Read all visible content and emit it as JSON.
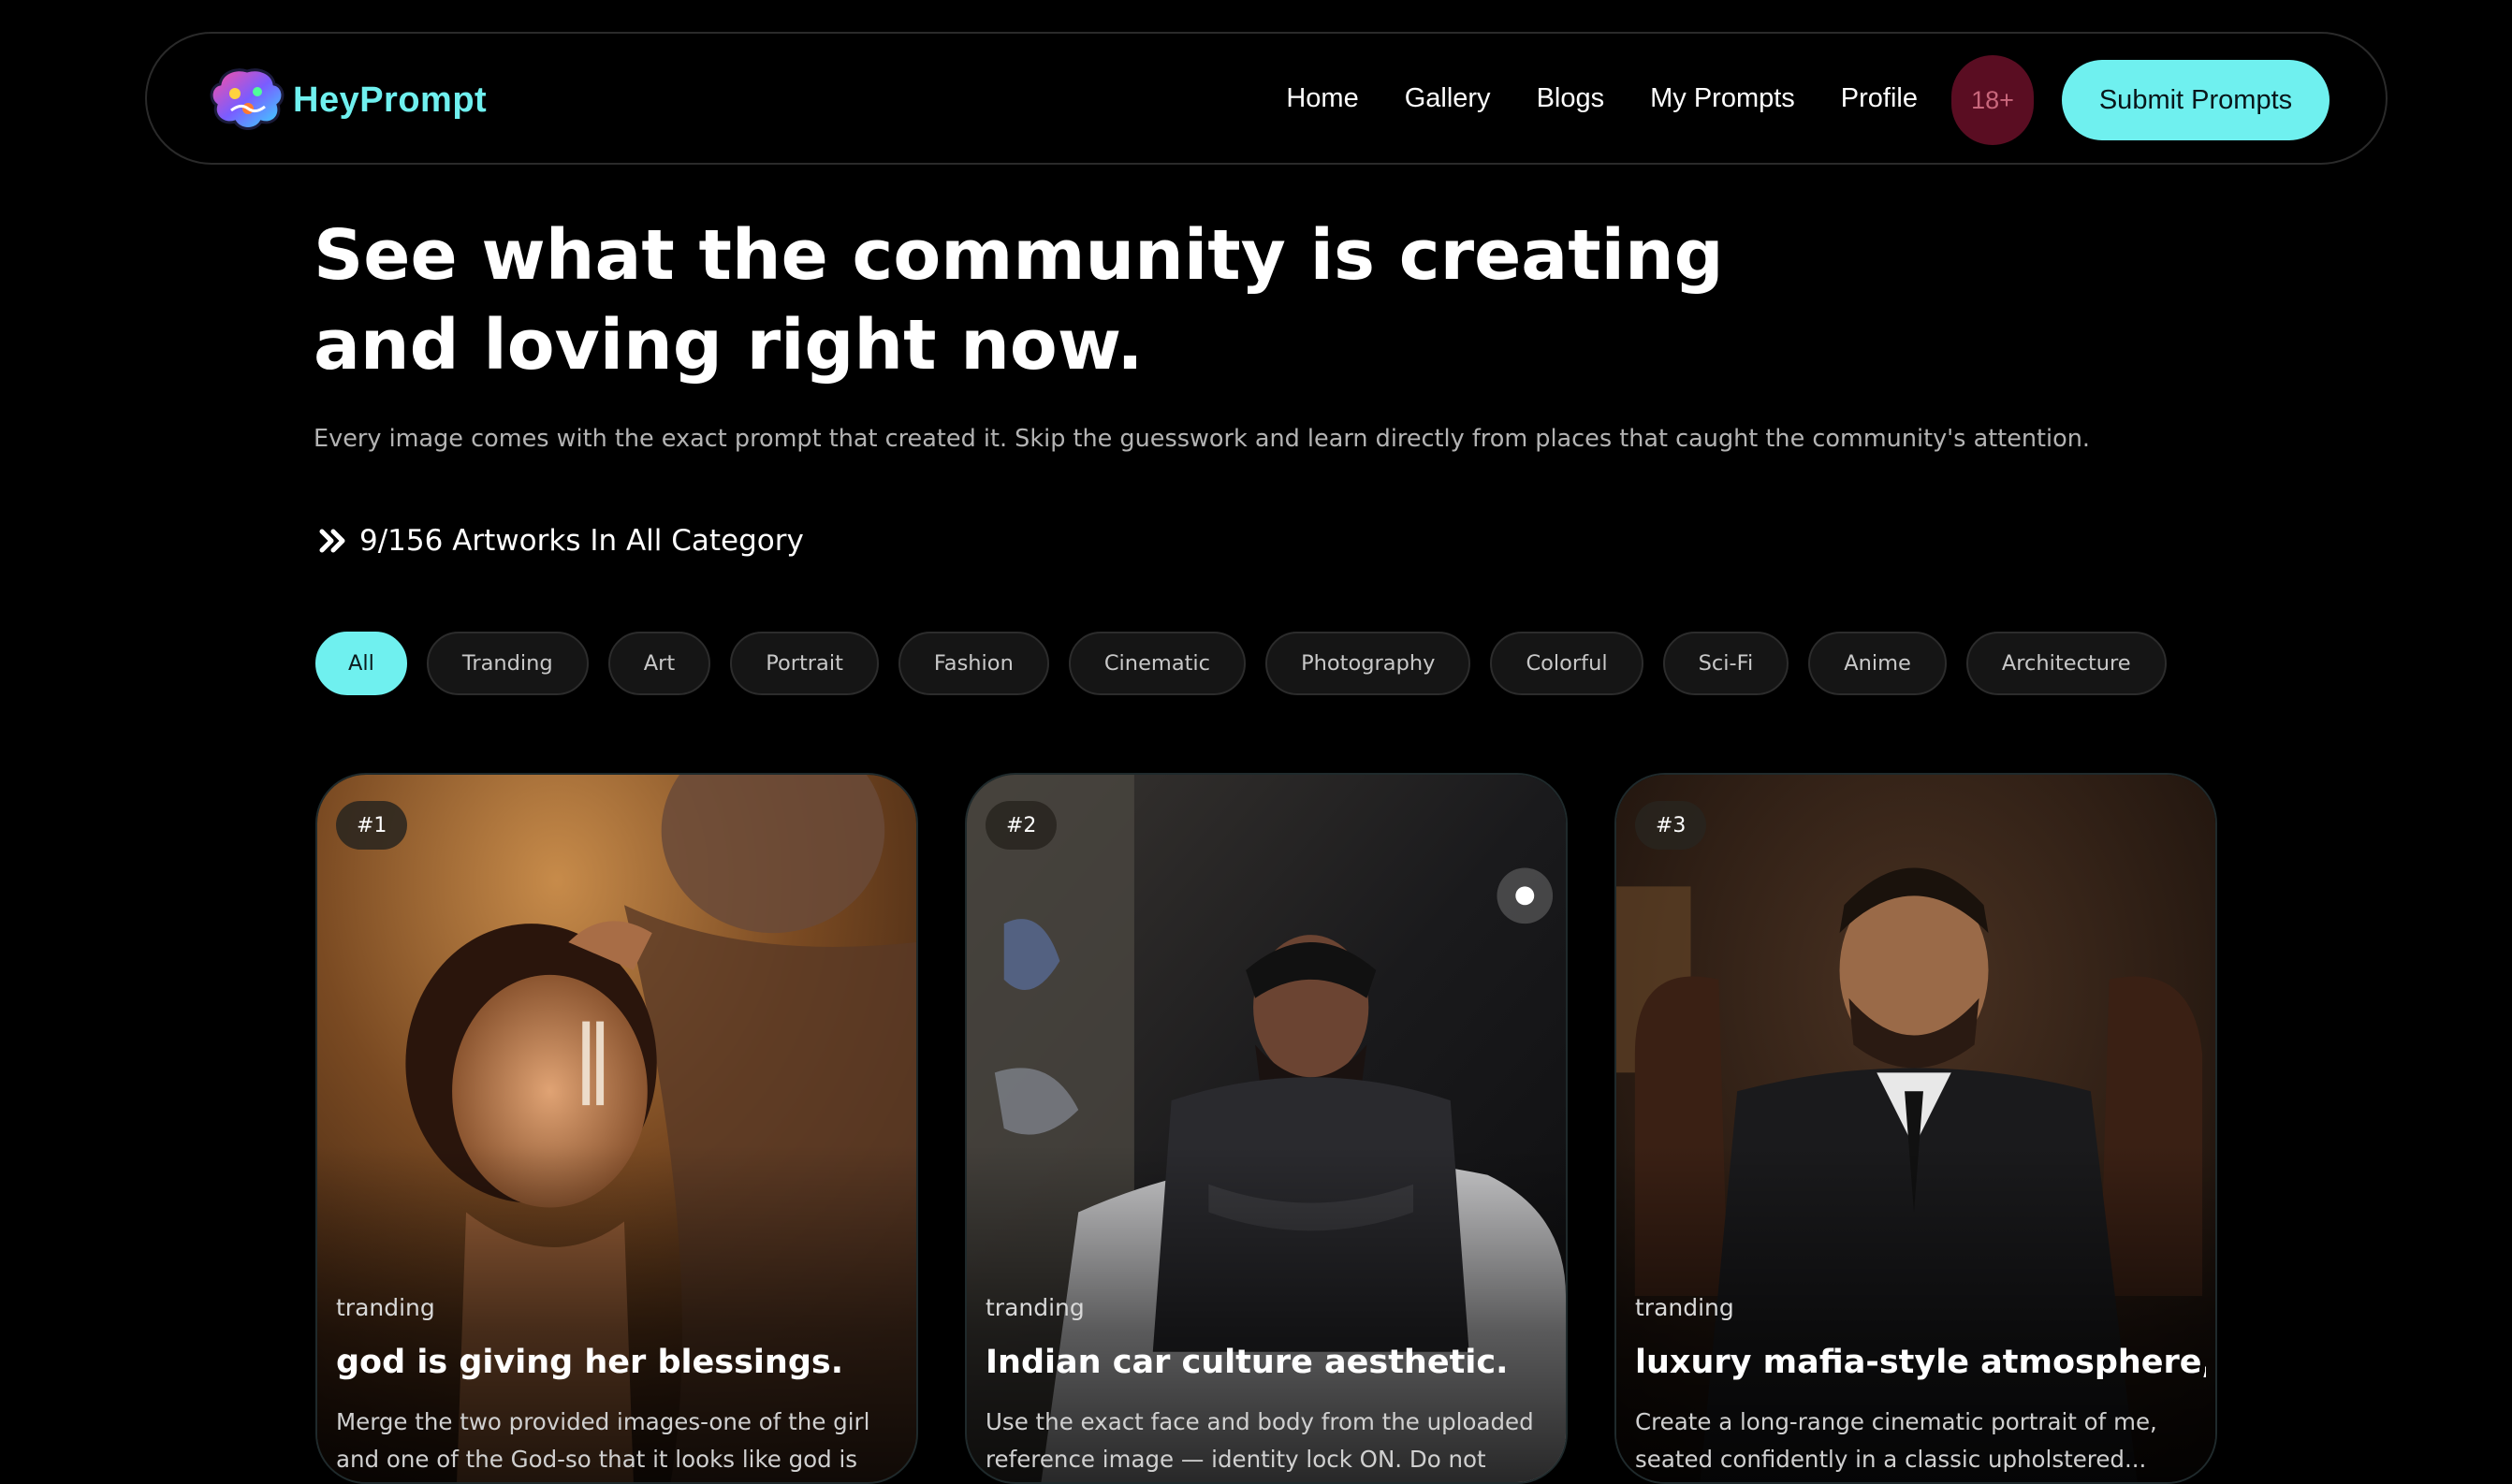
{
  "nav": {
    "logo_text": "HeyPrompt",
    "links": [
      "Home",
      "Gallery",
      "Blogs",
      "My Prompts",
      "Profile"
    ],
    "age_badge": "18+",
    "submit_label": "Submit Prompts"
  },
  "hero": {
    "title": "See what the community is creating and loving right now.",
    "subtitle": "Every image comes with the exact prompt that created it. Skip the guesswork and learn directly from places that caught the community's attention.",
    "count_text": "9/156 Artworks In All Category"
  },
  "categories": {
    "active": "All",
    "items": [
      "All",
      "Tranding",
      "Art",
      "Portrait",
      "Fashion",
      "Cinematic",
      "Photography",
      "Colorful",
      "Sci-Fi",
      "Anime",
      "Architecture"
    ]
  },
  "cards": [
    {
      "rank": "#1",
      "category": "tranding",
      "title": "god is giving her blessings.",
      "desc": "Merge the two provided images-one of the girl and one of the God-so that it looks like god is giving h..."
    },
    {
      "rank": "#2",
      "category": "tranding",
      "title": "Indian car culture aesthetic.",
      "desc": "Use the exact face and body from the uploaded reference image — identity lock ON. Do not chang..."
    },
    {
      "rank": "#3",
      "category": "tranding",
      "title": "luxury mafia-style atmosphere, s...",
      "desc": "Create a long-range cinematic portrait of me, seated confidently in a classic upholstered..."
    }
  ],
  "colors": {
    "accent": "#6ff0ef",
    "background": "#000000",
    "age_badge_bg": "#5a0d22"
  }
}
